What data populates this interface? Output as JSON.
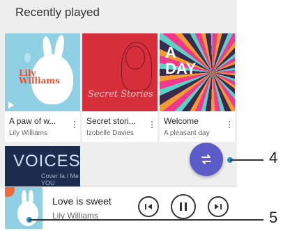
{
  "section_title": "Recently played",
  "cards": [
    {
      "title": "A paw of w...",
      "subtitle": "Lily Williams",
      "art_text_line1": "Lily",
      "art_text_line2": "Williams"
    },
    {
      "title": "Secret stori...",
      "subtitle": "Izobelle Davies",
      "art_text": "Secret Stories"
    },
    {
      "title": "Welcome",
      "subtitle": "A pleasant day",
      "art_text_line1": "A",
      "art_text_line2": "DAY"
    }
  ],
  "card4": {
    "art_text": "VOICES",
    "art_sub": "Cover fa / Me YOU"
  },
  "now_playing": {
    "title": "Love is sweet",
    "artist": "Lily Williams"
  },
  "callouts": {
    "fab": "4",
    "player": "5"
  },
  "colors": {
    "fab": "#5b5cc8",
    "callout_dot": "#1c8fc9",
    "background": "#eeeeee"
  }
}
